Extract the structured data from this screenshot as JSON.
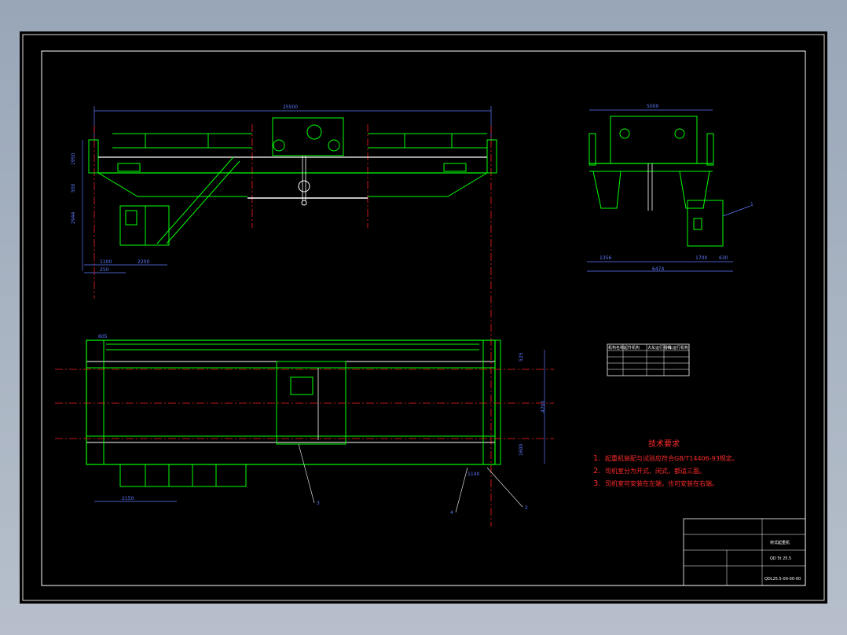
{
  "drawing": {
    "front_view": {
      "span_label": "25500",
      "height_labels": [
        "1950",
        "500",
        "2944"
      ],
      "bottom_labels": [
        "1100",
        "2200",
        "250"
      ]
    },
    "side_view": {
      "top_label": "5000",
      "bottom_labels": [
        "1356",
        "1700",
        "630"
      ],
      "total_label": "6474",
      "callout": "1"
    },
    "plan_view": {
      "left_label": "605",
      "right_labels": [
        "525",
        "4700",
        "1600"
      ],
      "bottom_left_label": "2150",
      "bottom_right_label": "1140",
      "callouts": [
        "3",
        "4",
        "2"
      ]
    },
    "spec_table": {
      "headers": [
        "机构名称",
        "起升机构",
        "大车运行机构",
        "小车运行机构"
      ],
      "rows": [
        [
          "",
          "",
          "",
          ""
        ],
        [
          "",
          "",
          "",
          ""
        ],
        [
          "",
          "",
          "",
          ""
        ],
        [
          "",
          "",
          "",
          ""
        ]
      ]
    },
    "requirements": {
      "title": "技术要求",
      "items": [
        {
          "num": "1.",
          "text": "起重机装配与试验应符合GB/T14406-93规定。"
        },
        {
          "num": "2.",
          "text": "司机室分为开式、闭式，都适三面。"
        },
        {
          "num": "3.",
          "text": "司机室可安装在左端，也可安装在右端。"
        }
      ]
    },
    "title_block": {
      "title": "桥式起重机",
      "spec": "QD 5t 25.5",
      "drawing_no": "QDL25.5-00-00-00"
    }
  }
}
